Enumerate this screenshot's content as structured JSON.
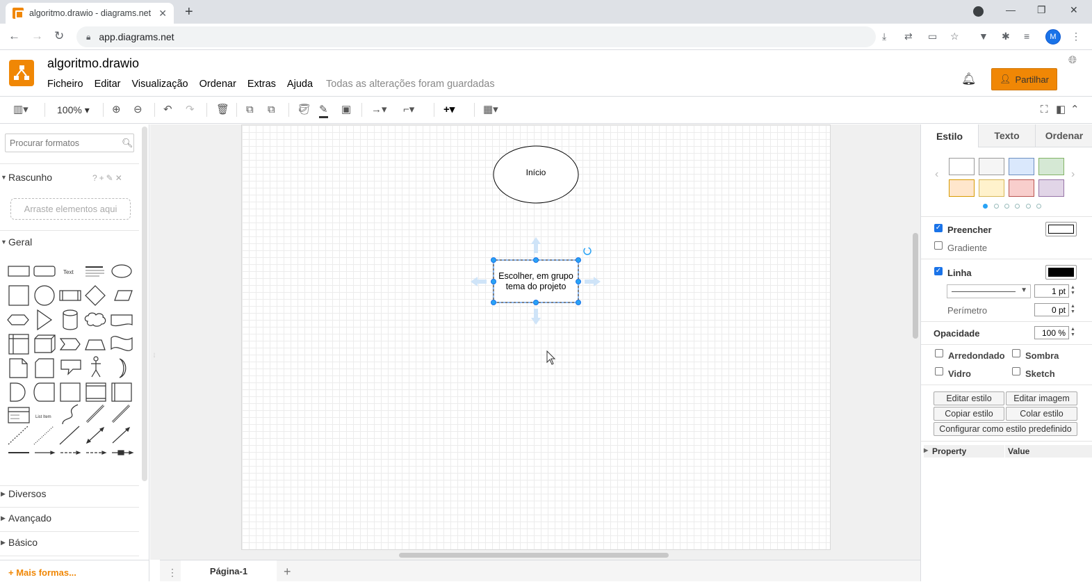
{
  "browser": {
    "tab_title": "algoritmo.drawio - diagrams.net",
    "url": "app.diagrams.net",
    "profile_initial": "M"
  },
  "app": {
    "doc_title": "algoritmo.drawio",
    "menu": [
      "Ficheiro",
      "Editar",
      "Visualização",
      "Ordenar",
      "Extras",
      "Ajuda"
    ],
    "save_status": "Todas as alterações foram guardadas",
    "share_label": "Partilhar"
  },
  "toolbar": {
    "zoom": "100%"
  },
  "left_panel": {
    "search_placeholder": "Procurar formatos",
    "scratchpad_title": "Rascunho",
    "scratchpad_drop": "Arraste elementos aqui",
    "general_title": "Geral",
    "shape_text_label": "Text",
    "shape_list_label": "List Item",
    "collapsed_sections": [
      "Diversos",
      "Avançado",
      "Básico"
    ],
    "more_shapes": "+ Mais formas..."
  },
  "diagram": {
    "start_label": "Início",
    "process_label_line1": "Escolher, em grupo",
    "process_label_line2": "tema do projeto"
  },
  "pages": {
    "current": "Página-1"
  },
  "right_panel": {
    "tabs": [
      "Estilo",
      "Texto",
      "Ordenar"
    ],
    "swatches": [
      "#ffffff",
      "#f5f5f5",
      "#dae8fc",
      "#d5e8d4",
      "#ffe6cc",
      "#fff2cc",
      "#f8cecc",
      "#e1d5e7"
    ],
    "fill_label": "Preencher",
    "fill_color": "#ffffff",
    "gradient_label": "Gradiente",
    "line_label": "Linha",
    "line_color": "#000000",
    "line_width": "1 pt",
    "perimeter_label": "Perímetro",
    "perimeter_value": "0 pt",
    "opacity_label": "Opacidade",
    "opacity_value": "100 %",
    "rounded_label": "Arredondado",
    "shadow_label": "Sombra",
    "glass_label": "Vidro",
    "sketch_label": "Sketch",
    "btn_edit_style": "Editar estilo",
    "btn_edit_image": "Editar imagem",
    "btn_copy_style": "Copiar estilo",
    "btn_paste_style": "Colar estilo",
    "btn_set_default": "Configurar como estilo predefinido",
    "prop_col": "Property",
    "value_col": "Value"
  },
  "colors": {
    "accent": "#f08705",
    "selection": "#1a73e8",
    "checkbox_on": "#1a73e8"
  }
}
